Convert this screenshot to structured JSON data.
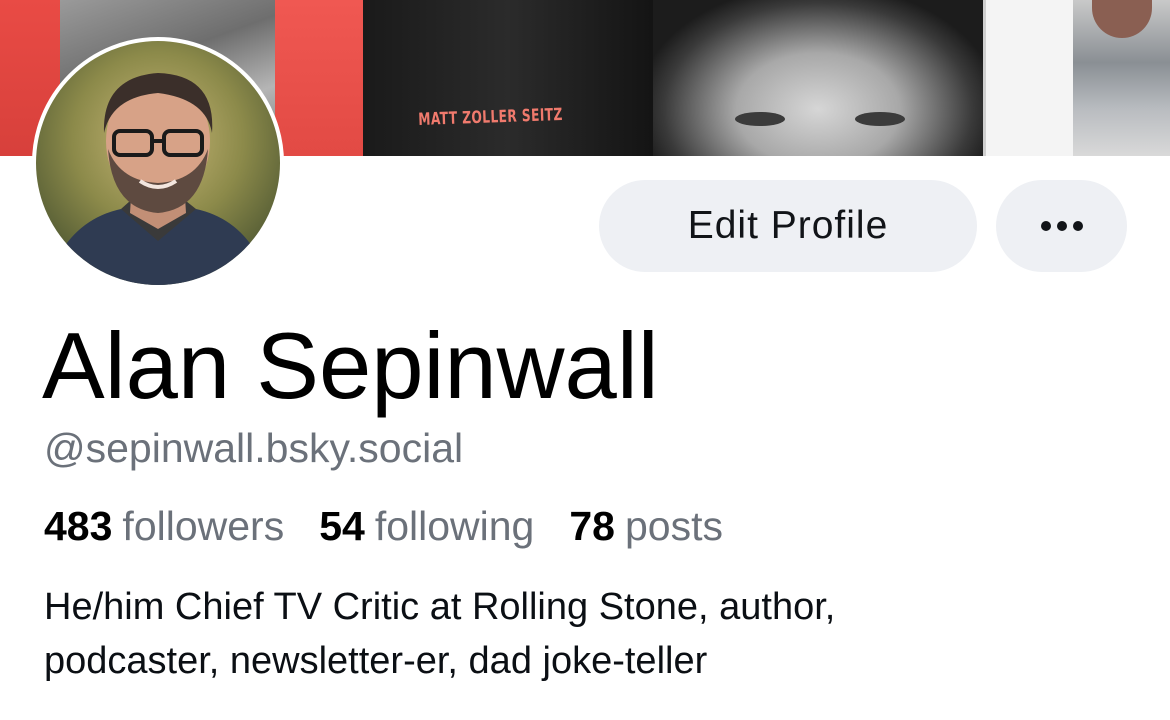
{
  "banner": {
    "book_text": "MATT ZOLLER SEITZ"
  },
  "profile": {
    "display_name": "Alan Sepinwall",
    "handle": "@sepinwall.bsky.social",
    "bio_lines": [
      "He/him Chief TV Critic at Rolling Stone, author,",
      "podcaster, newsletter-er, dad joke-teller"
    ]
  },
  "stats": {
    "followers_count": "483",
    "followers_label": "followers",
    "following_count": "54",
    "following_label": "following",
    "posts_count": "78",
    "posts_label": "posts"
  },
  "actions": {
    "edit_profile_label": "Edit Profile",
    "more_icon": "ellipsis-icon"
  },
  "colors": {
    "button_bg": "#eef0f4",
    "secondary_text": "#6b717a",
    "primary_text": "#000000"
  }
}
